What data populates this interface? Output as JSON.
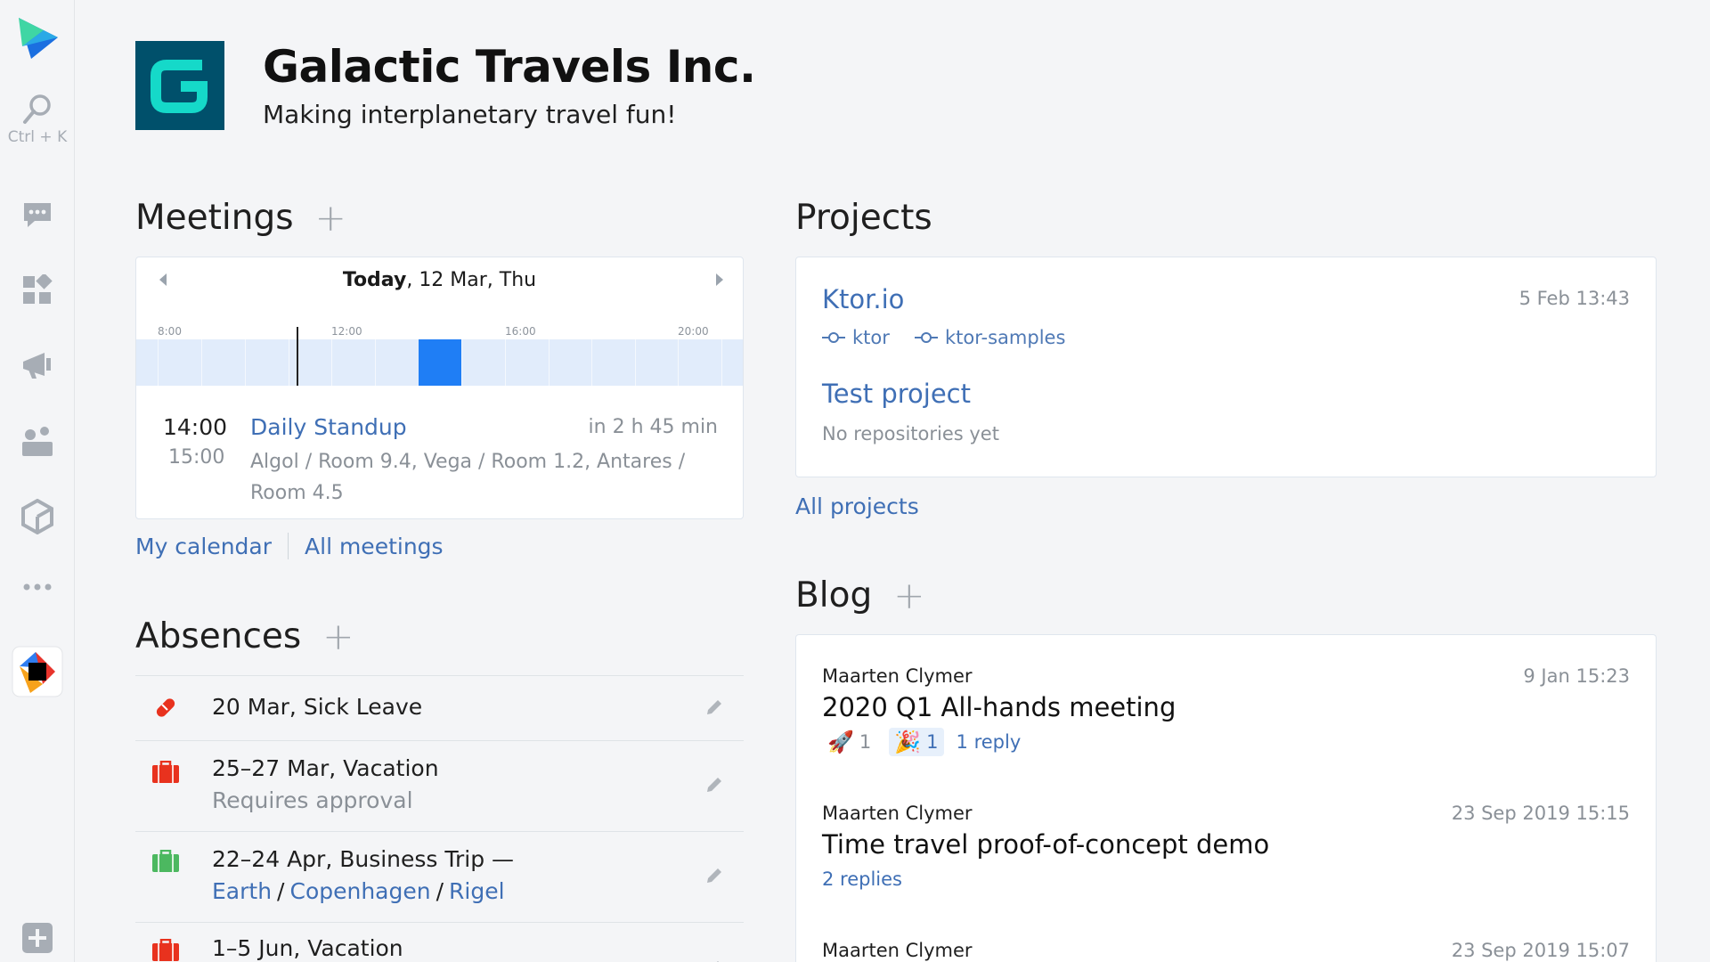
{
  "rail": {
    "search_hint": "Ctrl + K"
  },
  "header": {
    "company_name": "Galactic Travels Inc.",
    "tagline": "Making interplanetary travel fun!"
  },
  "meetings": {
    "title": "Meetings",
    "calendar": {
      "day_strong": "Today",
      "date_rest": ", 12 Mar, Thu",
      "time_labels": [
        "8:00",
        "12:00",
        "16:00",
        "20:00"
      ]
    },
    "event": {
      "start": "14:00",
      "end": "15:00",
      "title": "Daily Standup",
      "relative": "in 2 h 45 min",
      "rooms": "Algol / Room 9.4, Vega / Room 1.2, Antares / Room 4.5"
    },
    "links": {
      "my_calendar": "My calendar",
      "all_meetings": "All meetings"
    }
  },
  "absences": {
    "title": "Absences",
    "items": [
      {
        "text": "20 Mar, Sick Leave",
        "color": "#e8321e",
        "icon": "pill-icon"
      },
      {
        "text": "25–27 Mar, Vacation",
        "sub": "Requires approval",
        "color": "#e8321e",
        "icon": "suitcase-icon"
      },
      {
        "text": "22–24 Apr, Business Trip —",
        "locations": [
          "Earth",
          "Copenhagen",
          "Rigel"
        ],
        "color": "#4cb860",
        "icon": "suitcase-icon"
      },
      {
        "text": "1–5 Jun, Vacation",
        "color": "#e8321e",
        "icon": "suitcase-icon"
      }
    ]
  },
  "projects": {
    "title": "Projects",
    "items": [
      {
        "name": "Ktor.io",
        "date": "5 Feb 13:43",
        "repos": [
          "ktor",
          "ktor-samples"
        ]
      },
      {
        "name": "Test project",
        "empty": "No repositories yet"
      }
    ],
    "all_link": "All projects"
  },
  "blog": {
    "title": "Blog",
    "posts": [
      {
        "author": "Maarten Clymer",
        "date": "9 Jan 15:23",
        "title": "2020 Q1 All-hands meeting",
        "reactions": [
          {
            "emoji": "🚀",
            "count": "1"
          },
          {
            "emoji": "🎉",
            "count": "1"
          }
        ],
        "replies": "1 reply"
      },
      {
        "author": "Maarten Clymer",
        "date": "23 Sep 2019 15:15",
        "title": "Time travel proof-of-concept demo",
        "replies": "2 replies"
      },
      {
        "author": "Maarten Clymer",
        "date": "23 Sep 2019 15:07"
      }
    ]
  },
  "colors": {
    "accent": "#3f6fb5",
    "event_block": "#1f7ef5",
    "timeline_bg": "#e1ecfb",
    "logo_bg": "#00506b",
    "logo_fg": "#15d9c9"
  }
}
